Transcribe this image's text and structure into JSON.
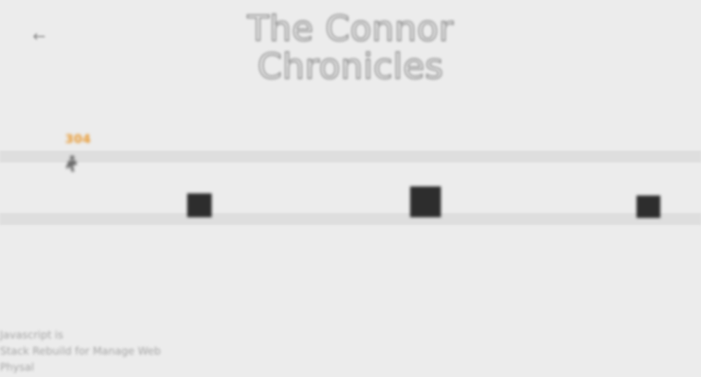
{
  "header": {
    "back_icon": "back-arrow-icon",
    "title": "The Connor Chronicles"
  },
  "hud": {
    "score": "304"
  },
  "game": {
    "player_icon": "runner-sprite-icon",
    "obstacle_count": 3,
    "colors": {
      "background": "#ececec",
      "lane": "#dedede",
      "obstacle": "#2d2d2d",
      "score": "#e89a33",
      "player": "#6a6a6a"
    }
  },
  "credits": {
    "lines": [
      "Javascript is",
      "Stack Rebuild for Manage Web",
      "Physal"
    ]
  }
}
